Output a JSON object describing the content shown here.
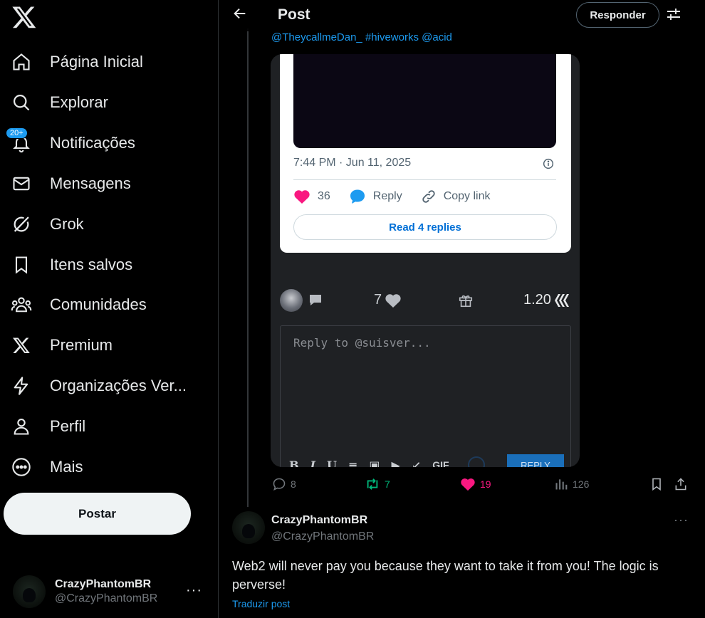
{
  "sidebar": {
    "nav": [
      {
        "label": "Página Inicial",
        "icon": "home-icon"
      },
      {
        "label": "Explorar",
        "icon": "search-icon"
      },
      {
        "label": "Notificações",
        "icon": "bell-icon",
        "badge": "20+"
      },
      {
        "label": "Mensagens",
        "icon": "mail-icon"
      },
      {
        "label": "Grok",
        "icon": "grok-icon"
      },
      {
        "label": "Itens salvos",
        "icon": "bookmark-icon"
      },
      {
        "label": "Comunidades",
        "icon": "communities-icon"
      },
      {
        "label": "Premium",
        "icon": "x-logo-icon"
      },
      {
        "label": "Organizações Ver...",
        "icon": "lightning-icon"
      },
      {
        "label": "Perfil",
        "icon": "person-icon"
      },
      {
        "label": "Mais",
        "icon": "more-circle-icon"
      }
    ],
    "post_button": "Postar",
    "account": {
      "name": "CrazyPhantomBR",
      "handle": "@CrazyPhantomBR",
      "more": "···"
    }
  },
  "header": {
    "title": "Post",
    "reply_button": "Responder"
  },
  "post": {
    "hashtags": "@TheycallmeDan_  #hiveworks @acid",
    "embed": {
      "time": "7:44 PM · Jun 11, 2025",
      "likes": "36",
      "reply_label": "Reply",
      "copy_link_label": "Copy link",
      "read_replies": "Read 4 replies"
    },
    "stats": {
      "votes": "7",
      "payout": "1.20"
    },
    "reply_box": {
      "placeholder": "Reply to @suisver...",
      "toolbar": [
        "B",
        "I",
        "U",
        "≡",
        "▣",
        "▶",
        "↙",
        "GIF"
      ],
      "submit": "REPLY"
    },
    "actions": {
      "replies": "8",
      "reposts": "7",
      "likes": "19",
      "views": "126"
    }
  },
  "reply": {
    "name": "CrazyPhantomBR",
    "handle": "@CrazyPhantomBR",
    "more": "···",
    "text": "Web2 will never pay you because they want to take it from you! The logic is perverse!",
    "translate": "Traduzir post"
  },
  "colors": {
    "accent": "#1d9bf0",
    "like": "#f91880",
    "repost": "#00ba7c",
    "background": "#000000"
  }
}
